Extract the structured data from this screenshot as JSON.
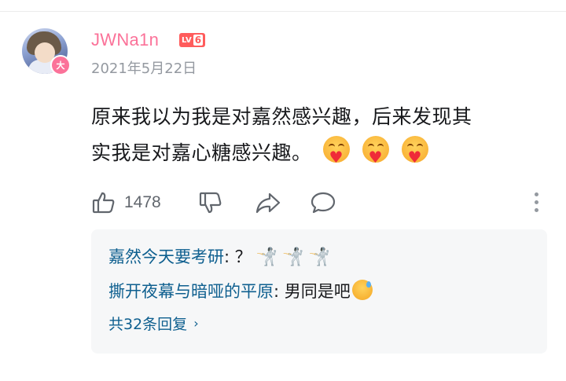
{
  "comment": {
    "username": "JWNa1n",
    "level": {
      "prefix": "LV",
      "number": "6"
    },
    "badge": "大",
    "date": "2021年5月22日",
    "text_line1": "原来我以为我是对嘉然感兴趣，后来发现其",
    "text_line2": "实我是对嘉心糖感兴趣。",
    "emoji": [
      "hugging-heart-emoji",
      "hugging-heart-emoji",
      "hugging-heart-emoji"
    ],
    "likes": "1478",
    "colors": {
      "username": "#fb7299",
      "link": "#0e5f8f",
      "level": "#ff5c5c"
    }
  },
  "replies": [
    {
      "name": "嘉然今天要考研",
      "sep": ":",
      "text": " ？",
      "emoji": [
        "fencer-emoji",
        "fencer-emoji",
        "fencer-emoji"
      ]
    },
    {
      "name": "撕开夜幕与暗哑的平原",
      "sep": ":",
      "text": " 男同是吧",
      "emoji": [
        "sweat-smile-emoji"
      ]
    }
  ],
  "more_replies": "共32条回复"
}
